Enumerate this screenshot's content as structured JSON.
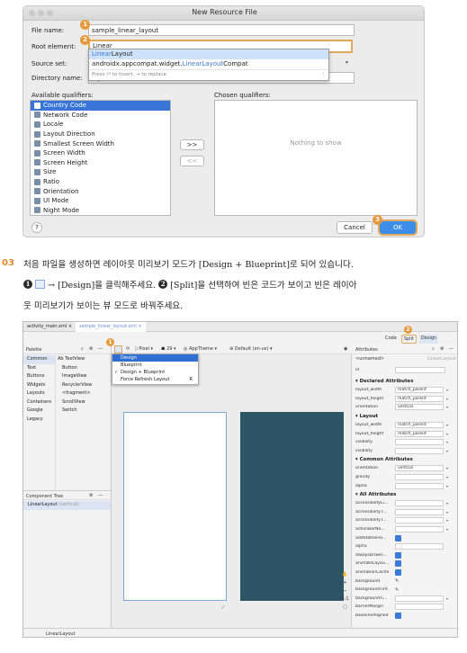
{
  "dialog": {
    "title": "New Resource File",
    "file_name_label": "File name:",
    "file_name_value": "sample_linear_layout",
    "root_element_label": "Root element:",
    "root_element_value": "Linear",
    "source_set_label": "Source set:",
    "directory_label": "Directory name:",
    "directory_value": "layout",
    "popup_item1_hl": "Linear",
    "popup_item1_rest": "Layout",
    "popup_item2_pre": "androidx.appcompat.widget.",
    "popup_item2_hl": "LinearLayout",
    "popup_item2_post": "Compat",
    "popup_hint": "Press ⏎ to insert, → to replace",
    "popup_more": "⋮",
    "available_label": "Available qualifiers:",
    "chosen_label": "Chosen qualifiers:",
    "qualifiers": [
      "Country Code",
      "Network Code",
      "Locale",
      "Layout Direction",
      "Smallest Screen Width",
      "Screen Width",
      "Screen Height",
      "Size",
      "Ratio",
      "Orientation",
      "UI Mode",
      "Night Mode"
    ],
    "nothing_to_show": "Nothing to show",
    "add_btn": ">>",
    "remove_btn": "<<",
    "help_btn": "?",
    "cancel_btn": "Cancel",
    "ok_btn": "OK",
    "badges": [
      "1",
      "2",
      "3"
    ]
  },
  "instructions": {
    "step_number": "03",
    "line1": "처음 파일을 생성하면 레이아웃 미리보기 모드가 [Design + Blueprint]로 되어 있습니다.",
    "n1": "1",
    "line2a": "→ [Design]을 클릭해주세요.",
    "n2": "2",
    "line2b": "[Split]을 선택하여 빈은 코드가 보이고 빈은 레이아",
    "line3": "웃 미리보기가 보이는 뷰 모드로 바꿔주세요."
  },
  "ide": {
    "tabs": [
      "activity_main.xml ×",
      "sample_linear_layout.xml ×"
    ],
    "view_modes": {
      "code": "Code",
      "split": "Split",
      "design": "Design"
    },
    "badge_split": "2",
    "badge_design_icon": "1",
    "palette": {
      "title": "Palette",
      "categories": [
        "Common",
        "Text",
        "Buttons",
        "Widgets",
        "Layouts",
        "Containers",
        "Google",
        "Legacy"
      ],
      "items": [
        "Ab TextView",
        "Button",
        "ImageView",
        "RecyclerView",
        "<fragment>",
        "ScrollView",
        "Switch"
      ]
    },
    "toolbar": {
      "device": "Pixel",
      "api": "29",
      "theme": "AppTheme",
      "locale": "Default (en-us)"
    },
    "mode_menu": {
      "items": [
        "Design",
        "Blueprint",
        "Design + Blueprint",
        "Force Refresh Layout"
      ],
      "checked_index": 2,
      "shortcut": "R"
    },
    "component_tree": {
      "title": "Component Tree",
      "root": "LinearLayout",
      "root_suffix": "(vertical)"
    },
    "status": "LinearLayout",
    "attributes": {
      "title": "Attributes",
      "id_label": "id",
      "unnamed": "<unnamed>",
      "class": "LinearLayout",
      "declared_title": "Declared Attributes",
      "declared": [
        [
          "layout_width",
          "match_parent"
        ],
        [
          "layout_height",
          "match_parent"
        ],
        [
          "orientation",
          "vertical"
        ]
      ],
      "layout_title": "Layout",
      "layout": [
        [
          "layout_width",
          "match_parent"
        ],
        [
          "layout_height",
          "match_parent"
        ],
        [
          "visibility",
          ""
        ],
        [
          "visibility",
          ""
        ]
      ],
      "common_title": "Common Attributes",
      "common": [
        [
          "orientation",
          "vertical"
        ],
        [
          "gravity",
          ""
        ],
        [
          "alpha",
          ""
        ]
      ],
      "all_title": "All Attributes",
      "all": [
        "accessibilityLi...",
        "accessibilityT...",
        "accessibilityT...",
        "actionBarNa...",
        "addStatesFro...",
        "alpha",
        "alwaysDrawn...",
        "animateLayou...",
        "animationCache",
        "background",
        "backgroundTint",
        "backgroundTi...",
        "barrierMargin",
        "baselineAligned"
      ]
    }
  }
}
